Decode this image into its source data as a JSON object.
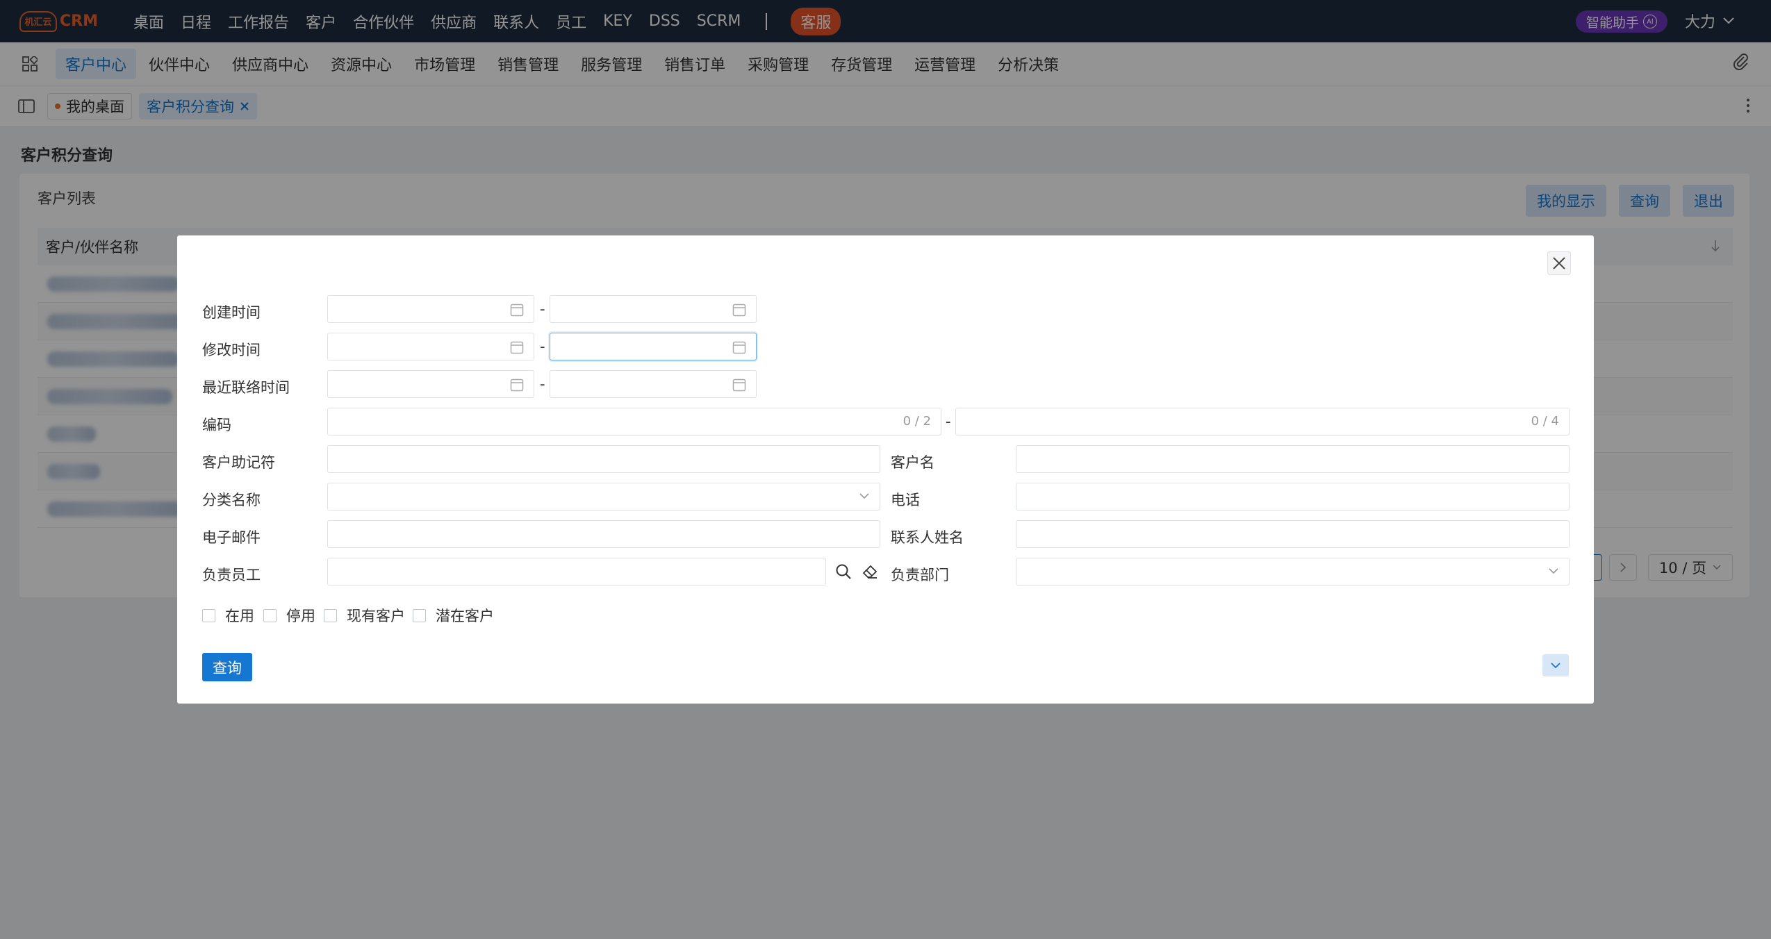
{
  "app": {
    "logo_badge": "机汇云",
    "logo_text": "CRM"
  },
  "top_nav": [
    "桌面",
    "日程",
    "工作报告",
    "客户",
    "合作伙伴",
    "供应商",
    "联系人",
    "员工",
    "KEY",
    "DSS",
    "SCRM"
  ],
  "kefu_label": "客服",
  "ai_assistant": {
    "label": "智能助手",
    "badge": "AI"
  },
  "user_name": "大力",
  "second_nav": [
    "客户中心",
    "伙伴中心",
    "供应商中心",
    "资源中心",
    "市场管理",
    "销售管理",
    "服务管理",
    "销售订单",
    "采购管理",
    "存货管理",
    "运营管理",
    "分析决策"
  ],
  "second_nav_active": "客户中心",
  "tabs": [
    {
      "label": "我的桌面",
      "active": false,
      "dot": true
    },
    {
      "label": "客户积分查询",
      "active": true,
      "closable": true
    }
  ],
  "page": {
    "title": "客户积分查询",
    "card_title": "客户列表",
    "buttons": [
      "我的显示",
      "查询",
      "退出"
    ],
    "table_header": "客户/伙伴名称",
    "page_size": "10 / 页"
  },
  "modal": {
    "labels": {
      "created": "创建时间",
      "modified": "修改时间",
      "last_contact": "最近联络时间",
      "code": "编码",
      "mnemonic": "客户助记符",
      "customer_name": "客户名",
      "category": "分类名称",
      "phone": "电话",
      "email": "电子邮件",
      "contact_name": "联系人姓名",
      "employee": "负责员工",
      "department": "负责部门"
    },
    "range_separator": "-",
    "code_from_count": "0 / 2",
    "code_to_count": "0 / 4",
    "checkboxes": [
      "在用",
      "停用",
      "现有客户",
      "潜在客户"
    ],
    "query_button": "查询"
  },
  "colors": {
    "topbar": "#1e2d3f",
    "accent": "#1677d2",
    "brand": "#e8622a",
    "ai": "#6a36b8"
  }
}
